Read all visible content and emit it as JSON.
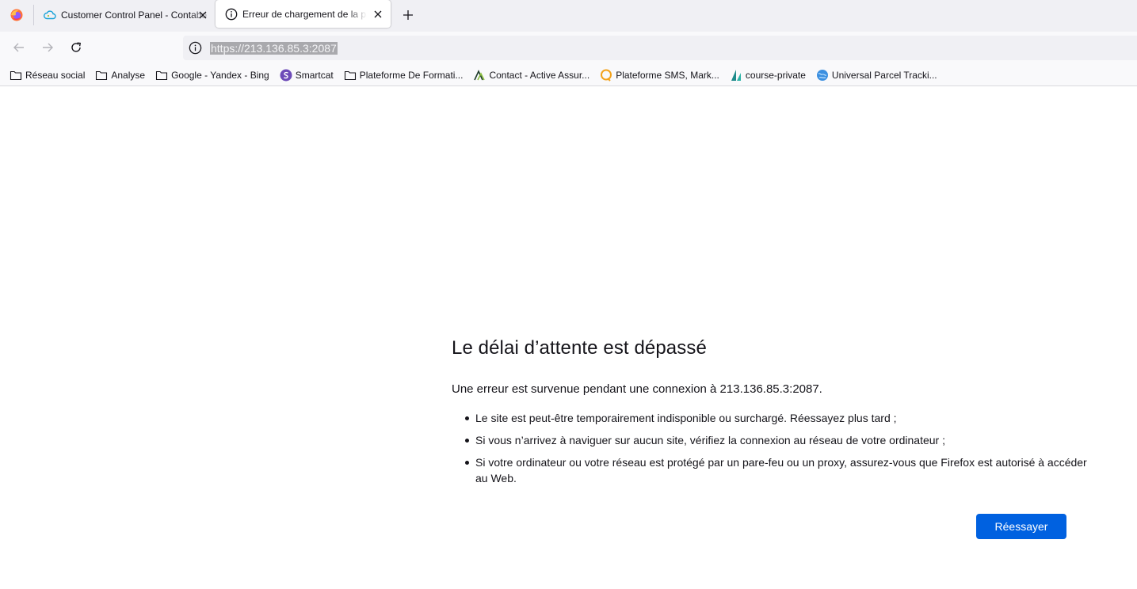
{
  "tabs": [
    {
      "label": "Customer Control Panel - Contabo",
      "icon": "cloud-icon",
      "active": false
    },
    {
      "label": "Erreur de chargement de la page",
      "icon": "info-icon",
      "active": true
    }
  ],
  "navbar": {
    "url": "https://213.136.85.3:2087"
  },
  "bookmarks": [
    {
      "label": "Réseau social",
      "icon": "folder-icon"
    },
    {
      "label": "Analyse",
      "icon": "folder-icon"
    },
    {
      "label": "Google - Yandex - Bing",
      "icon": "folder-icon"
    },
    {
      "label": "Smartcat",
      "icon": "smartcat-icon"
    },
    {
      "label": "Plateforme De Formati...",
      "icon": "folder-icon"
    },
    {
      "label": "Contact - Active Assur...",
      "icon": "active-assur-icon"
    },
    {
      "label": "Plateforme SMS, Mark...",
      "icon": "sms-icon"
    },
    {
      "label": "course-private",
      "icon": "course-icon"
    },
    {
      "label": "Universal Parcel Tracki...",
      "icon": "globe-icon"
    }
  ],
  "error": {
    "title": "Le délai d’attente est dépassé",
    "subtitle": "Une erreur est survenue pendant une connexion à 213.136.85.3:2087.",
    "items": [
      "Le site est peut-être temporairement indisponible ou surchargé. Réessayez plus tard ;",
      "Si vous n’arrivez à naviguer sur aucun site, vérifiez la connexion au réseau de votre ordinateur ;",
      "Si votre ordinateur ou votre réseau est protégé par un pare-feu ou un proxy, assurez-vous que Firefox est autorisé à accéder au Web."
    ],
    "retry_label": "Réessayer"
  },
  "colors": {
    "accent": "#0061e0",
    "tabstrip": "#f0f0f4",
    "toolbar": "#f9f9fb"
  }
}
